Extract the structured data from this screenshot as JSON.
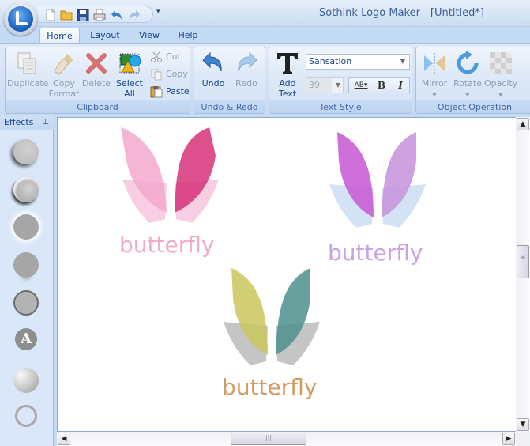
{
  "window": {
    "title": "Sothink Logo Maker - [Untitled*]"
  },
  "quick_access": {
    "icons": [
      "new-file-icon",
      "open-folder-icon",
      "save-icon",
      "print-icon",
      "undo-icon",
      "redo-icon"
    ],
    "more_label": "▾"
  },
  "tabs": [
    {
      "label": "Home",
      "active": true
    },
    {
      "label": "Layout",
      "active": false
    },
    {
      "label": "View",
      "active": false
    },
    {
      "label": "Help",
      "active": false
    }
  ],
  "ribbon": {
    "clipboard": {
      "label": "Clipboard",
      "duplicate": "Duplicate",
      "copy_format_1": "Copy",
      "copy_format_2": "Format",
      "delete": "Delete",
      "select_all_1": "Select",
      "select_all_2": "All",
      "cut": "Cut",
      "copy": "Copy",
      "paste": "Paste"
    },
    "undo_redo": {
      "label": "Undo & Redo",
      "undo": "Undo",
      "redo": "Redo"
    },
    "text_style": {
      "label": "Text Style",
      "add_text_1": "Add",
      "add_text_2": "Text",
      "font": "Sansation",
      "size": "39",
      "spacing": "AB",
      "bold": "B",
      "italic": "I"
    },
    "object_operation": {
      "label": "Object Operation",
      "mirror": "Mirror",
      "rotate": "Rotate",
      "opacity": "Opacity"
    }
  },
  "effects_panel": {
    "title": "Effects",
    "pin": "⊥",
    "items": [
      "shadow-effect",
      "bevel-effect",
      "glow-effect",
      "reflection-effect",
      "stroke-effect",
      "text-effect",
      "gradient-effect",
      "outline-effect"
    ],
    "text_effect_letter": "A"
  },
  "canvas": {
    "logos": [
      {
        "text": "butterfly",
        "text_color": "#f1a9cd",
        "wing_left": "#f3a8cc",
        "wing_right": "#d6317a",
        "back": "#f6c2dc"
      },
      {
        "text": "butterfly",
        "text_color": "#c9a2e6",
        "wing_left": "#c756d3",
        "wing_right": "#c592dc",
        "back": "#c8dcf3"
      },
      {
        "text": "butterfly",
        "text_color": "#d49a60",
        "wing_left": "#c9c65a",
        "wing_right": "#4e8f8d",
        "back": "#b7b7b7"
      }
    ]
  },
  "scrollbars": {
    "vertical_position": 0.45,
    "horizontal_position": 0.45
  }
}
